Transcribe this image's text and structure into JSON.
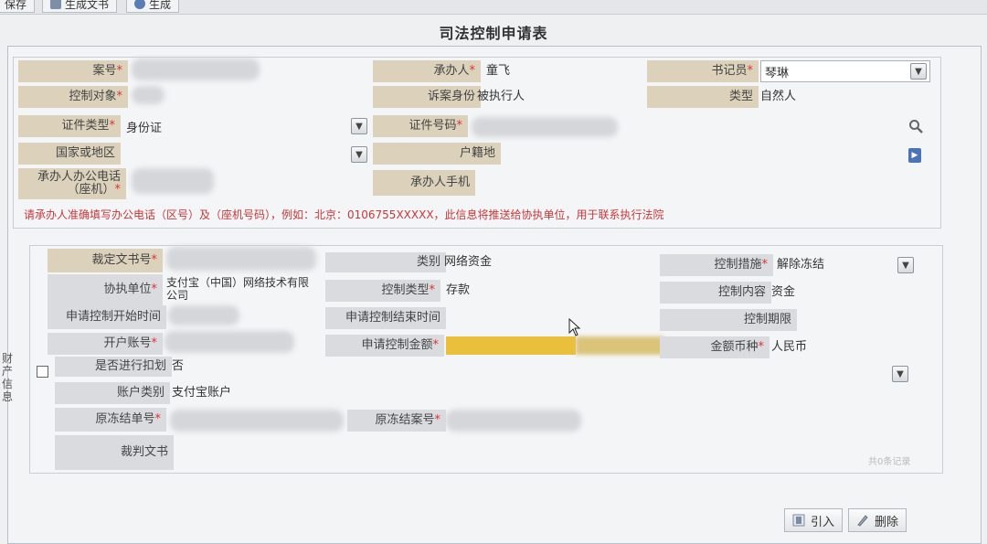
{
  "toolbar": {
    "btn1": "保存",
    "btn2": "生成文书",
    "btn3": "生成"
  },
  "form": {
    "title": "司法控制申请表"
  },
  "case": {
    "case_no_label": "案号",
    "handler_label": "承办人",
    "handler_value": "童飞",
    "clerk_label": "书记员",
    "clerk_value": "琴琳",
    "target_label": "控制对象",
    "party_role_label": "诉案身份",
    "party_role_value": "被执行人",
    "type_label": "类型",
    "type_value": "自然人",
    "id_type_label": "证件类型",
    "id_type_value": "身份证",
    "id_no_label": "证件号码",
    "country_label": "国家或地区",
    "domicile_label": "户籍地",
    "office_phone_label_1": "承办人办公电话",
    "office_phone_label_2": "（座机）",
    "mobile_label": "承办人手机",
    "hint": "请承办人准确填写办公电话（区号）及（座机号码），例如：北京：0106755XXXXX，此信息将推送给协执单位，用于联系执行法院"
  },
  "property": {
    "side_label": "财产信息",
    "ruling_no_label": "裁定文书号",
    "category_label": "类别",
    "category_value": "网络资金",
    "measure_label": "控制措施",
    "measure_value": "解除冻结",
    "assist_unit_label": "协执单位",
    "assist_unit_value": "支付宝（中国）网络技术有限公司",
    "control_type_label": "控制类型",
    "control_type_value": "存款",
    "control_content_label": "控制内容",
    "control_content_value": "资金",
    "start_time_label": "申请控制开始时间",
    "end_time_label": "申请控制结束时间",
    "period_label": "控制期限",
    "account_label": "开户账号",
    "amount_label": "申请控制金额",
    "currency_label": "金额币种",
    "currency_value": "人民币",
    "deduct_label": "是否进行扣划",
    "deduct_value": "否",
    "account_type_label": "账户类别",
    "account_type_value": "支付宝账户",
    "orig_freeze_no_label": "原冻结单号",
    "orig_freeze_case_label": "原冻结案号",
    "judgment_doc_label": "裁判文书",
    "pager": "共0条记录"
  },
  "buttons": {
    "import": "引入",
    "delete": "删除"
  },
  "colors": {
    "label_bg": "#dcd2bc",
    "required": "#d33333",
    "hint": "#c8373a",
    "highlight": "#e9bf3c"
  }
}
